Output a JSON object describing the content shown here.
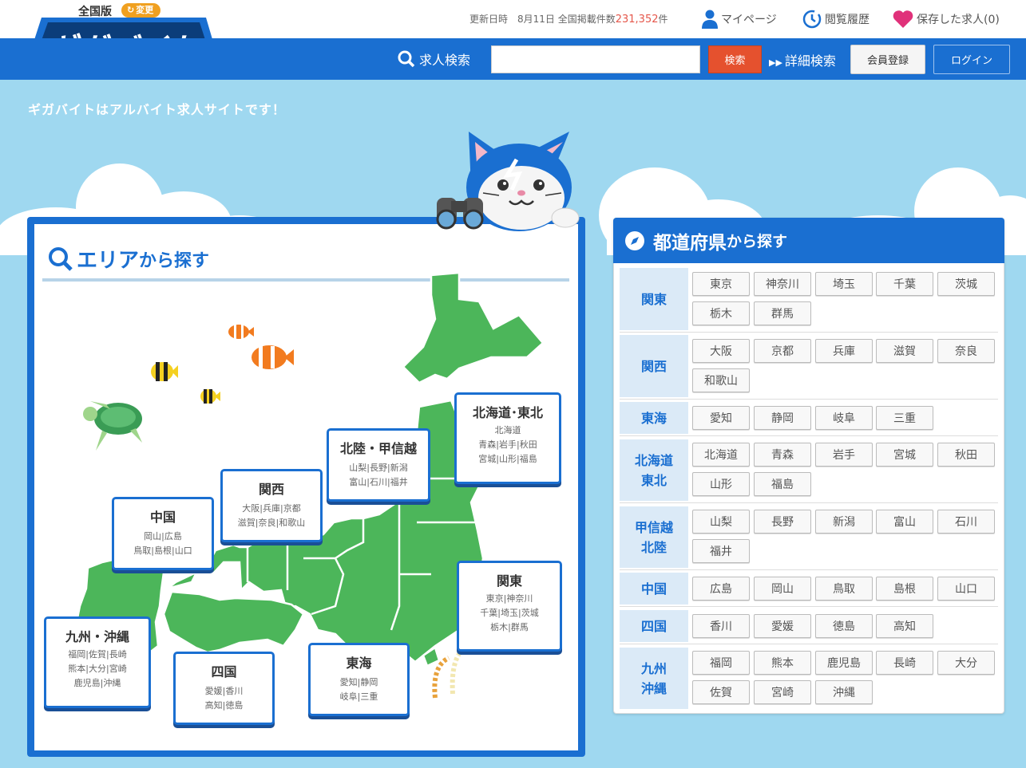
{
  "header": {
    "nationwide": "全国版",
    "change_label": "変更",
    "logo_text": "ギガバイト",
    "update_label": "更新日時　8月11日 全国掲載件数",
    "listing_count": "231,352",
    "count_suffix": "件",
    "mypage": "マイページ",
    "history": "閲覧履歴",
    "saved": "保存した求人(0)"
  },
  "nav": {
    "search_label": "求人検索",
    "search_value": "",
    "search_button": "検索",
    "advanced_search": "詳細検索",
    "register": "会員登録",
    "login": "ログイン"
  },
  "hero": {
    "tagline": "ギガバイトはアルバイト求人サイトです！"
  },
  "area": {
    "title_main": "エリア",
    "title_suffix": "から探す",
    "regions": [
      {
        "name": "北海道･東北",
        "lines": [
          "北海道",
          "青森|岩手|秋田",
          "宮城|山形|福島"
        ]
      },
      {
        "name": "北陸・甲信越",
        "lines": [
          "山梨|長野|新潟",
          "富山|石川|福井"
        ]
      },
      {
        "name": "関西",
        "lines": [
          "大阪|兵庫|京都",
          "滋賀|奈良|和歌山"
        ]
      },
      {
        "name": "中国",
        "lines": [
          "岡山|広島",
          "鳥取|島根|山口"
        ]
      },
      {
        "name": "関東",
        "lines": [
          "東京|神奈川",
          "千葉|埼玉|茨城",
          "栃木|群馬"
        ]
      },
      {
        "name": "九州・沖縄",
        "lines": [
          "福岡|佐賀|長崎",
          "熊本|大分|宮崎",
          "鹿児島|沖縄"
        ]
      },
      {
        "name": "四国",
        "lines": [
          "愛媛|香川",
          "高知|徳島"
        ]
      },
      {
        "name": "東海",
        "lines": [
          "愛知|静岡",
          "岐阜|三重"
        ]
      }
    ]
  },
  "prefectures": {
    "title_main": "都道府県",
    "title_suffix": "から探す",
    "rows": [
      {
        "label": "関東",
        "prefs": [
          "東京",
          "神奈川",
          "埼玉",
          "千葉",
          "茨城",
          "栃木",
          "群馬"
        ]
      },
      {
        "label": "関西",
        "prefs": [
          "大阪",
          "京都",
          "兵庫",
          "滋賀",
          "奈良",
          "和歌山"
        ]
      },
      {
        "label": "東海",
        "prefs": [
          "愛知",
          "静岡",
          "岐阜",
          "三重"
        ]
      },
      {
        "label": "北海道東北",
        "label_lines": [
          "北海道",
          "東北"
        ],
        "prefs": [
          "北海道",
          "青森",
          "岩手",
          "宮城",
          "秋田",
          "山形",
          "福島"
        ]
      },
      {
        "label": "甲信越北陸",
        "label_lines": [
          "甲信越",
          "北陸"
        ],
        "prefs": [
          "山梨",
          "長野",
          "新潟",
          "富山",
          "石川",
          "福井"
        ]
      },
      {
        "label": "中国",
        "prefs": [
          "広島",
          "岡山",
          "鳥取",
          "島根",
          "山口"
        ]
      },
      {
        "label": "四国",
        "prefs": [
          "香川",
          "愛媛",
          "徳島",
          "高知"
        ]
      },
      {
        "label": "九州沖縄",
        "label_lines": [
          "九州",
          "沖縄"
        ],
        "prefs": [
          "福岡",
          "熊本",
          "鹿児島",
          "長崎",
          "大分",
          "佐賀",
          "宮崎",
          "沖縄"
        ]
      }
    ]
  },
  "colors": {
    "brand_blue": "#1a6fd1",
    "sky": "#9fd8f0",
    "map_green": "#4cb65a",
    "accent_red": "#e5512e",
    "count_red": "#e5574b",
    "heart_pink": "#e0317a"
  }
}
